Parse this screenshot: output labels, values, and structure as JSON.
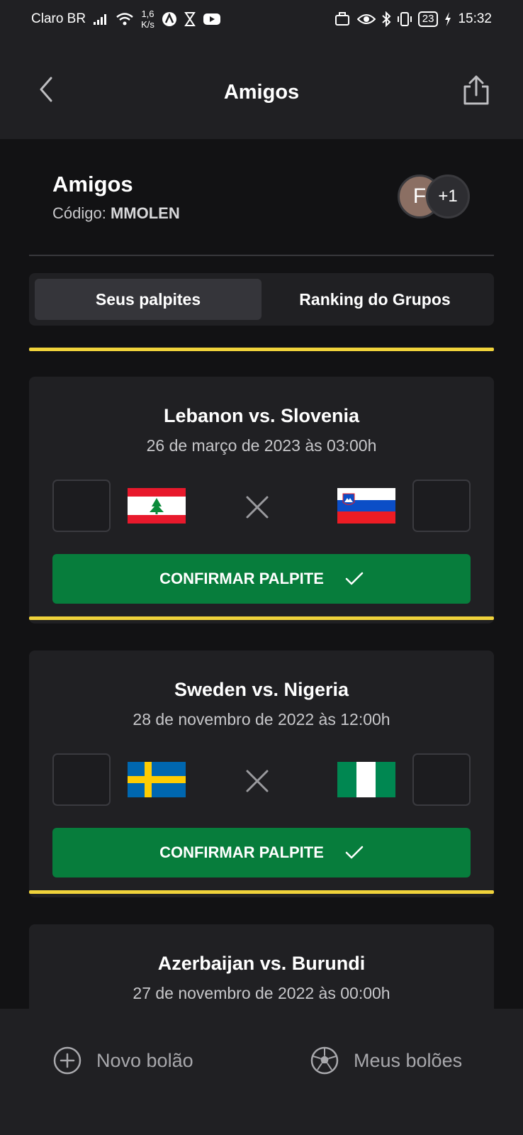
{
  "status_bar": {
    "carrier": "Claro BR",
    "speed_value": "1,6",
    "speed_unit": "K/s",
    "battery": "23",
    "time": "15:32"
  },
  "app_bar": {
    "title": "Amigos"
  },
  "group": {
    "name": "Amigos",
    "code_label": "Código:",
    "code_value": "MMOLEN",
    "avatar_initial": "F",
    "avatar_more": "+1"
  },
  "tabs": [
    {
      "label": "Seus palpites",
      "active": true
    },
    {
      "label": "Ranking do Grupos",
      "active": false
    }
  ],
  "matches": [
    {
      "title": "Lebanon vs. Slovenia",
      "date": "26 de março de 2023 às 03:00h",
      "home_flag": "lebanon-flag",
      "away_flag": "slovenia-flag",
      "home_score": "",
      "away_score": "",
      "button_label": "CONFIRMAR PALPITE"
    },
    {
      "title": "Sweden vs. Nigeria",
      "date": "28 de novembro de 2022 às 12:00h",
      "home_flag": "sweden-flag",
      "away_flag": "nigeria-flag",
      "home_score": "",
      "away_score": "",
      "button_label": "CONFIRMAR PALPITE"
    },
    {
      "title": "Azerbaijan vs. Burundi",
      "date": "27 de novembro de 2022 às 00:00h"
    }
  ],
  "bottom_nav": [
    {
      "label": "Novo bolão",
      "icon": "plus-circle-icon"
    },
    {
      "label": "Meus bolões",
      "icon": "soccer-ball-icon"
    }
  ],
  "colors": {
    "background": "#121214",
    "surface": "#202023",
    "accent_yellow": "#f0d33b",
    "confirm_green": "#077d3c"
  }
}
